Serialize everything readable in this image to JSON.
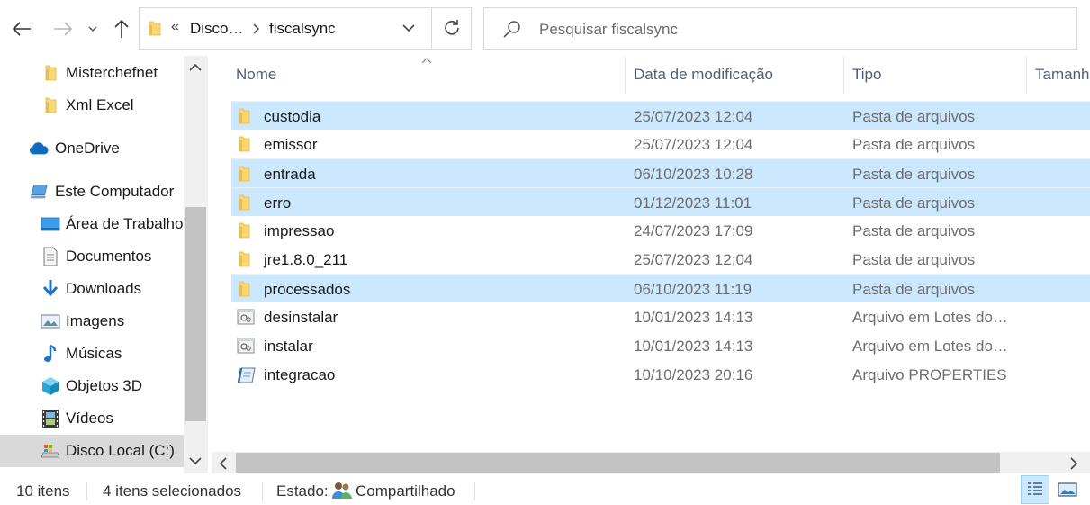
{
  "address": {
    "prefix": "«",
    "crumbs": [
      "Disco…",
      "fiscalsync"
    ]
  },
  "search": {
    "placeholder": "Pesquisar fiscalsync"
  },
  "nav": {
    "items": [
      {
        "label": "Misterchefnet",
        "icon": "folder-icon"
      },
      {
        "label": "Xml Excel",
        "icon": "folder-icon"
      },
      {
        "label": "OneDrive",
        "icon": "cloud-icon"
      },
      {
        "label": "Este Computador",
        "icon": "computer-icon"
      },
      {
        "label": "Área de Trabalho",
        "icon": "desktop-icon"
      },
      {
        "label": "Documentos",
        "icon": "document-icon"
      },
      {
        "label": "Downloads",
        "icon": "download-arrow-icon"
      },
      {
        "label": "Imagens",
        "icon": "picture-icon"
      },
      {
        "label": "Músicas",
        "icon": "music-note-icon"
      },
      {
        "label": "Objetos 3D",
        "icon": "cube-icon"
      },
      {
        "label": "Vídeos",
        "icon": "film-icon"
      },
      {
        "label": "Disco Local (C:)",
        "icon": "drive-icon"
      }
    ]
  },
  "columns": {
    "name": "Nome",
    "date": "Data de modificação",
    "type": "Tipo",
    "size": "Tamanh"
  },
  "files": [
    {
      "name": "custodia",
      "date": "25/07/2023 12:04",
      "type": "Pasta de arquivos",
      "kind": "folder",
      "selected": true
    },
    {
      "name": "emissor",
      "date": "25/07/2023 12:04",
      "type": "Pasta de arquivos",
      "kind": "folder",
      "selected": false
    },
    {
      "name": "entrada",
      "date": "06/10/2023 10:28",
      "type": "Pasta de arquivos",
      "kind": "folder",
      "selected": true
    },
    {
      "name": "erro",
      "date": "01/12/2023 11:01",
      "type": "Pasta de arquivos",
      "kind": "folder",
      "selected": true
    },
    {
      "name": "impressao",
      "date": "24/07/2023 17:09",
      "type": "Pasta de arquivos",
      "kind": "folder",
      "selected": false
    },
    {
      "name": "jre1.8.0_211",
      "date": "25/07/2023 12:04",
      "type": "Pasta de arquivos",
      "kind": "folder",
      "selected": false
    },
    {
      "name": "processados",
      "date": "06/10/2023 11:19",
      "type": "Pasta de arquivos",
      "kind": "folder",
      "selected": true
    },
    {
      "name": "desinstalar",
      "date": "10/01/2023 14:13",
      "type": "Arquivo em Lotes do…",
      "kind": "batch",
      "selected": false
    },
    {
      "name": "instalar",
      "date": "10/01/2023 14:13",
      "type": "Arquivo em Lotes do…",
      "kind": "batch",
      "selected": false
    },
    {
      "name": "integracao",
      "date": "10/10/2023 20:16",
      "type": "Arquivo PROPERTIES",
      "kind": "properties",
      "selected": false
    }
  ],
  "status": {
    "count": "10 itens",
    "selected": "4 itens selecionados",
    "state_label": "Estado:",
    "state_value": "Compartilhado"
  },
  "colors": {
    "selection": "#cce8ff",
    "folder": "#f8d775",
    "header_text": "#4c607a"
  }
}
